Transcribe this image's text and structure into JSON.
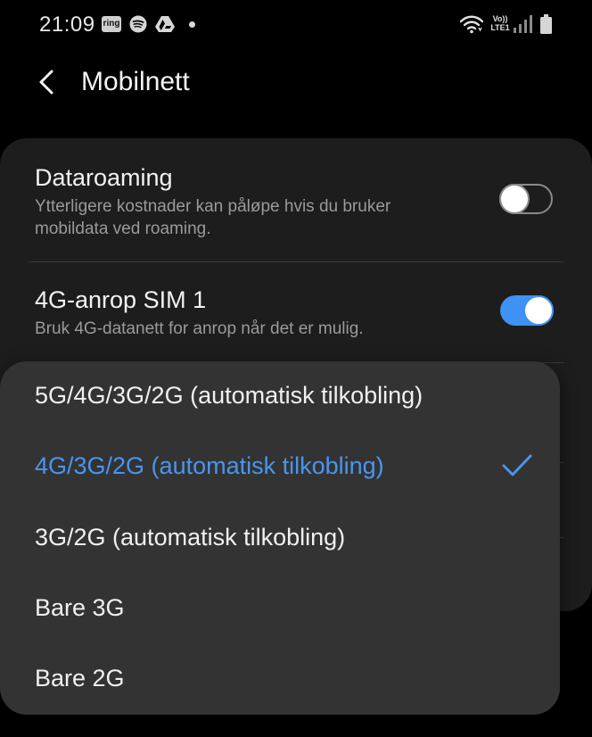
{
  "status_bar": {
    "time": "21:09",
    "ring_label": "ring",
    "volte_top": "Vo))",
    "volte_bottom": "LTE1"
  },
  "header": {
    "title": "Mobilnett"
  },
  "settings": [
    {
      "title": "Dataroaming",
      "subtitle": "Ytterligere kostnader kan påløpe hvis du bruker mobildata ved roaming.",
      "toggle": "off"
    },
    {
      "title": "4G-anrop SIM 1",
      "subtitle": "Bruk 4G-datanett for anrop når det er mulig.",
      "toggle": "on"
    }
  ],
  "network_mode_menu": {
    "options": [
      {
        "label": "5G/4G/3G/2G (automatisk tilkobling)",
        "selected": false
      },
      {
        "label": "4G/3G/2G (automatisk tilkobling)",
        "selected": true
      },
      {
        "label": "3G/2G (automatisk tilkobling)",
        "selected": false
      },
      {
        "label": "Bare 3G",
        "selected": false
      },
      {
        "label": "Bare 2G",
        "selected": false
      }
    ]
  },
  "colors": {
    "accent": "#3e91f5",
    "selected_text": "#4a95ee",
    "background": "#000000",
    "card": "#1d1d1d",
    "popup": "#333333"
  },
  "icons": [
    "back-arrow-icon",
    "spotify-icon",
    "google-drive-icon",
    "wifi-icon",
    "signal-icon",
    "battery-icon",
    "check-icon"
  ]
}
